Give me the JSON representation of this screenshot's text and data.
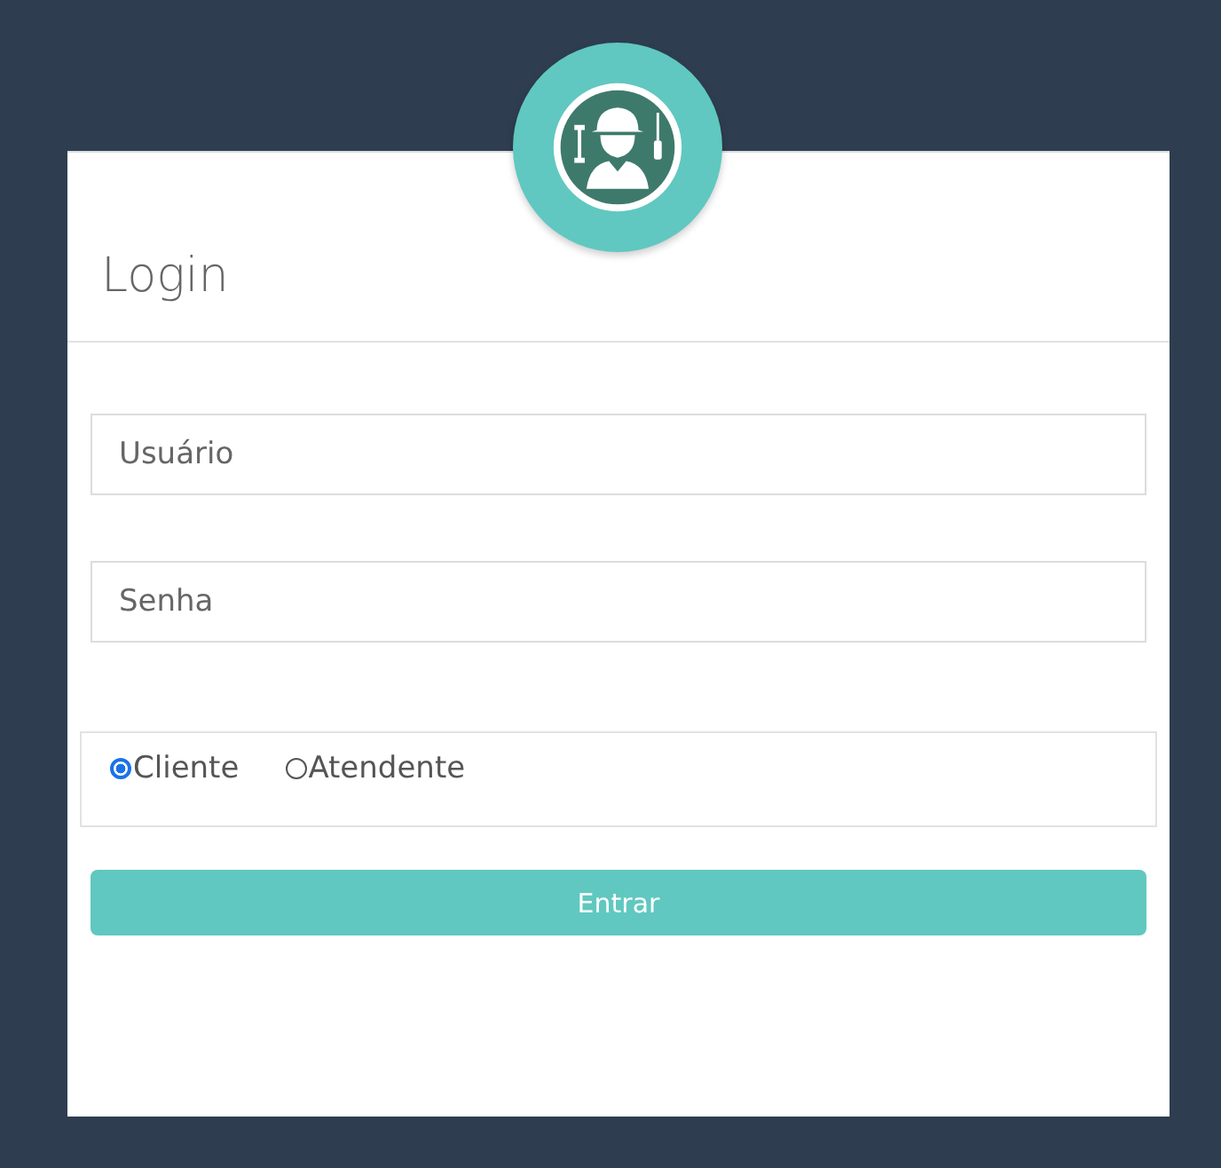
{
  "title": "Login",
  "fields": [
    {
      "placeholder": "Usuário"
    },
    {
      "placeholder": "Senha"
    }
  ],
  "radios": [
    {
      "label": "Cliente",
      "selected": true
    },
    {
      "label": "Atendente",
      "selected": false
    }
  ],
  "submit": "Entrar"
}
